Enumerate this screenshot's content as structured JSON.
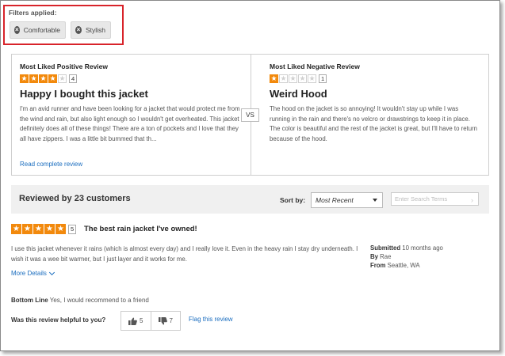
{
  "filters": {
    "title": "Filters applied:",
    "chips": [
      {
        "label": "Comfortable",
        "icon": "remove-circle-icon"
      },
      {
        "label": "Stylish",
        "icon": "remove-circle-icon"
      }
    ]
  },
  "top_reviews": {
    "positive": {
      "heading": "Most Liked Positive Review",
      "rating": 4,
      "rating_label": "4",
      "title": "Happy I bought this jacket",
      "body": "I'm an avid runner and have been looking for a jacket that would protect me from the wind and rain, but also light enough so I wouldn't get overheated. This jacket definitely does all of these things! There are a ton of pockets and I love that they all have zippers. I was a little bit bummed that th...",
      "link": "Read complete review"
    },
    "vs_label": "VS",
    "negative": {
      "heading": "Most Liked Negative Review",
      "rating": 1,
      "rating_label": "1",
      "title": "Weird Hood",
      "body": "The hood on the jacket is so annoying! It wouldn't stay up while I was running in the rain and there's no velcro or drawstrings to keep it in place. The color is beautiful and the rest of the jacket is great, but I'll have to return because of the hood."
    }
  },
  "reviews_bar": {
    "title": "Reviewed by 23 customers",
    "sort_label": "Sort by:",
    "sort_value": "Most Recent",
    "search_placeholder": "Enter Search Terms",
    "search_arrow": "›"
  },
  "review": {
    "rating": 5,
    "rating_label": "5",
    "title": "The best rain jacket I've owned!",
    "body": "I use this jacket whenever it rains (which is almost every day) and I really love it. Even in the heavy rain I stay dry underneath. I wish it was a wee bit warmer, but I just layer and it works for me.",
    "submitted_label": "Submitted",
    "submitted_value": "10 months ago",
    "by_label": "By",
    "by_value": "Rae",
    "from_label": "From",
    "from_value": "Seattle, WA",
    "more_details": "More Details",
    "bottom_line_label": "Bottom Line",
    "bottom_line_value": "Yes, I would recommend to a friend",
    "helpful_question": "Was this review helpful to you?",
    "upvotes": "5",
    "downvotes": "7",
    "flag": "Flag this review"
  },
  "colors": {
    "star_on": "#f2890c",
    "link": "#1a6dbf",
    "highlight_border": "#d8232a"
  }
}
